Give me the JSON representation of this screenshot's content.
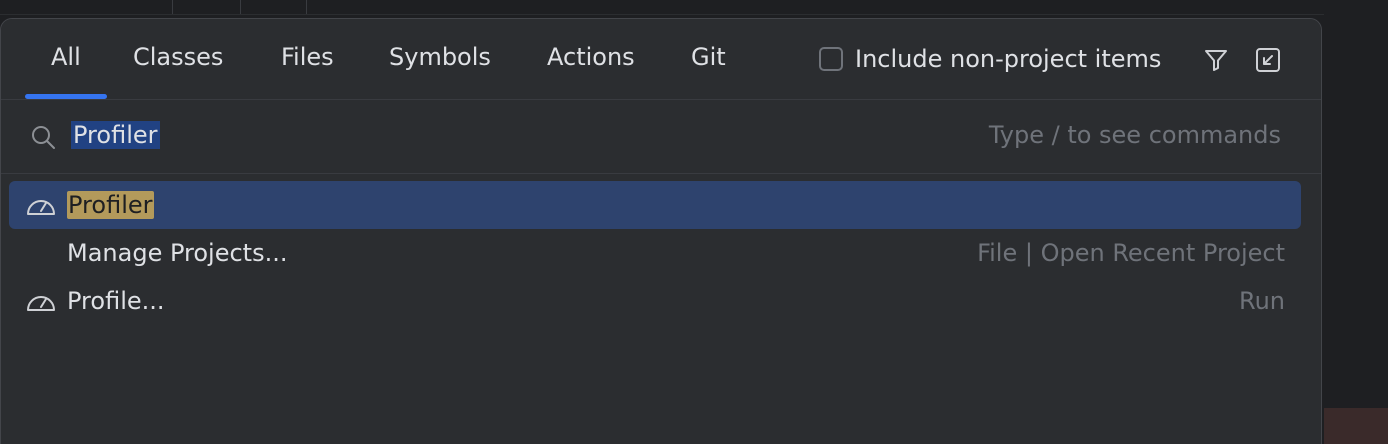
{
  "tabs": [
    {
      "label": "All",
      "active": true
    },
    {
      "label": "Classes",
      "active": false
    },
    {
      "label": "Files",
      "active": false
    },
    {
      "label": "Symbols",
      "active": false
    },
    {
      "label": "Actions",
      "active": false
    },
    {
      "label": "Git",
      "active": false
    }
  ],
  "include_non_project": {
    "label": "Include non-project items",
    "checked": false
  },
  "toolbar_icons": [
    "filter-icon",
    "collapse-to-corner-icon"
  ],
  "search": {
    "value": "Profiler",
    "hint": "Type / to see commands"
  },
  "results": [
    {
      "label": "Profiler",
      "highlight": "Profiler",
      "hint": "",
      "icon": "gauge-icon",
      "selected": true
    },
    {
      "label": "Manage Projects...",
      "hint": "File | Open Recent Project",
      "icon": "",
      "selected": false
    },
    {
      "label": "Profile...",
      "hint": "Run",
      "icon": "gauge-icon",
      "selected": false
    }
  ],
  "colors": {
    "accent": "#3574f0",
    "selection": "#2e436e",
    "match_highlight": "#b39a5b",
    "popup_bg": "#2b2d30"
  }
}
